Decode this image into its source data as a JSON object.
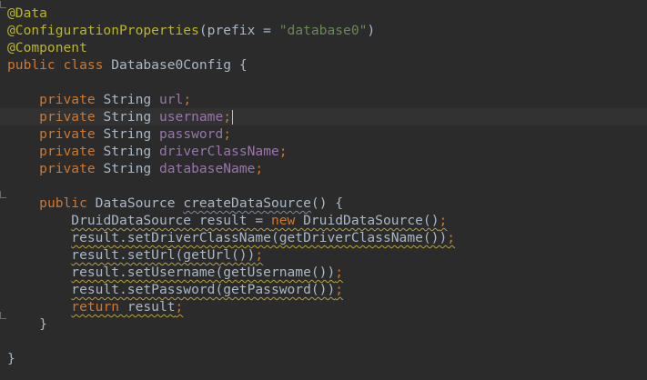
{
  "editor": {
    "lines": [
      {
        "tokens": [
          {
            "t": "@Data",
            "c": "ann"
          }
        ]
      },
      {
        "tokens": [
          {
            "t": "@ConfigurationProperties",
            "c": "ann"
          },
          {
            "t": "(prefix = ",
            "c": "fn"
          },
          {
            "t": "\"database0\"",
            "c": "str"
          },
          {
            "t": ")",
            "c": "fn"
          }
        ]
      },
      {
        "tokens": [
          {
            "t": "@Component",
            "c": "ann"
          }
        ]
      },
      {
        "tokens": [
          {
            "t": "public class ",
            "c": "kw"
          },
          {
            "t": "Database0Config {",
            "c": "fn"
          }
        ]
      },
      {
        "tokens": []
      },
      {
        "tokens": [
          {
            "t": "    "
          },
          {
            "t": "private ",
            "c": "kw"
          },
          {
            "t": "String ",
            "c": "fn"
          },
          {
            "t": "url",
            "c": "fld"
          },
          {
            "t": ";",
            "c": "kw"
          }
        ]
      },
      {
        "current": true,
        "caret_after": true,
        "tokens": [
          {
            "t": "    "
          },
          {
            "t": "private ",
            "c": "kw"
          },
          {
            "t": "String ",
            "c": "fn"
          },
          {
            "t": "username",
            "c": "fld"
          },
          {
            "t": ";",
            "c": "kw"
          }
        ]
      },
      {
        "tokens": [
          {
            "t": "    "
          },
          {
            "t": "private ",
            "c": "kw"
          },
          {
            "t": "String ",
            "c": "fn"
          },
          {
            "t": "password",
            "c": "fld"
          },
          {
            "t": ";",
            "c": "kw"
          }
        ]
      },
      {
        "tokens": [
          {
            "t": "    "
          },
          {
            "t": "private ",
            "c": "kw"
          },
          {
            "t": "String ",
            "c": "fn"
          },
          {
            "t": "driverClassName",
            "c": "fld"
          },
          {
            "t": ";",
            "c": "kw"
          }
        ]
      },
      {
        "tokens": [
          {
            "t": "    "
          },
          {
            "t": "private ",
            "c": "kw"
          },
          {
            "t": "String ",
            "c": "fn"
          },
          {
            "t": "databaseName",
            "c": "fld"
          },
          {
            "t": ";",
            "c": "kw"
          }
        ]
      },
      {
        "tokens": []
      },
      {
        "tokens": [
          {
            "t": "    "
          },
          {
            "t": "public ",
            "c": "kw"
          },
          {
            "t": "DataSource ",
            "c": "fn"
          },
          {
            "t": "createDataSource",
            "c": "fn sq-fn"
          },
          {
            "t": "() {",
            "c": "fn"
          }
        ]
      },
      {
        "tokens": [
          {
            "t": "        "
          },
          {
            "t": "DruidDataSource result = ",
            "c": "fn sq"
          },
          {
            "t": "new ",
            "c": "kw sq"
          },
          {
            "t": "DruidDataSource()",
            "c": "fn sq"
          },
          {
            "t": ";",
            "c": "kw sq"
          }
        ]
      },
      {
        "tokens": [
          {
            "t": "        "
          },
          {
            "t": "result.setDriverClassName(getDriverClassName())",
            "c": "fn sq"
          },
          {
            "t": ";",
            "c": "kw sq"
          }
        ]
      },
      {
        "tokens": [
          {
            "t": "        "
          },
          {
            "t": "result.setUrl(getUrl())",
            "c": "fn sq"
          },
          {
            "t": ";",
            "c": "kw sq"
          }
        ]
      },
      {
        "tokens": [
          {
            "t": "        "
          },
          {
            "t": "result.setUsername(getUsername())",
            "c": "fn sq"
          },
          {
            "t": ";",
            "c": "kw sq"
          }
        ]
      },
      {
        "tokens": [
          {
            "t": "        "
          },
          {
            "t": "result.setPassword(getPassword())",
            "c": "fn sq"
          },
          {
            "t": ";",
            "c": "kw sq"
          }
        ]
      },
      {
        "tokens": [
          {
            "t": "        "
          },
          {
            "t": "return ",
            "c": "kw sq"
          },
          {
            "t": "result",
            "c": "fn sq"
          },
          {
            "t": ";",
            "c": "kw sq"
          }
        ]
      },
      {
        "tokens": [
          {
            "t": "    "
          },
          {
            "t": "}",
            "c": "fn"
          }
        ]
      },
      {
        "tokens": []
      },
      {
        "tokens": [
          {
            "t": "}",
            "c": "fn"
          }
        ]
      }
    ],
    "gutter_marks": [
      0,
      11,
      18
    ],
    "colors": {
      "background": "#2b2b2b",
      "current_line": "#323232",
      "annotation": "#bbb529",
      "keyword": "#cc7832",
      "field": "#9876aa",
      "string": "#6a8759",
      "default": "#a9b7c6",
      "warning_squiggle": "#b5a33e"
    }
  }
}
